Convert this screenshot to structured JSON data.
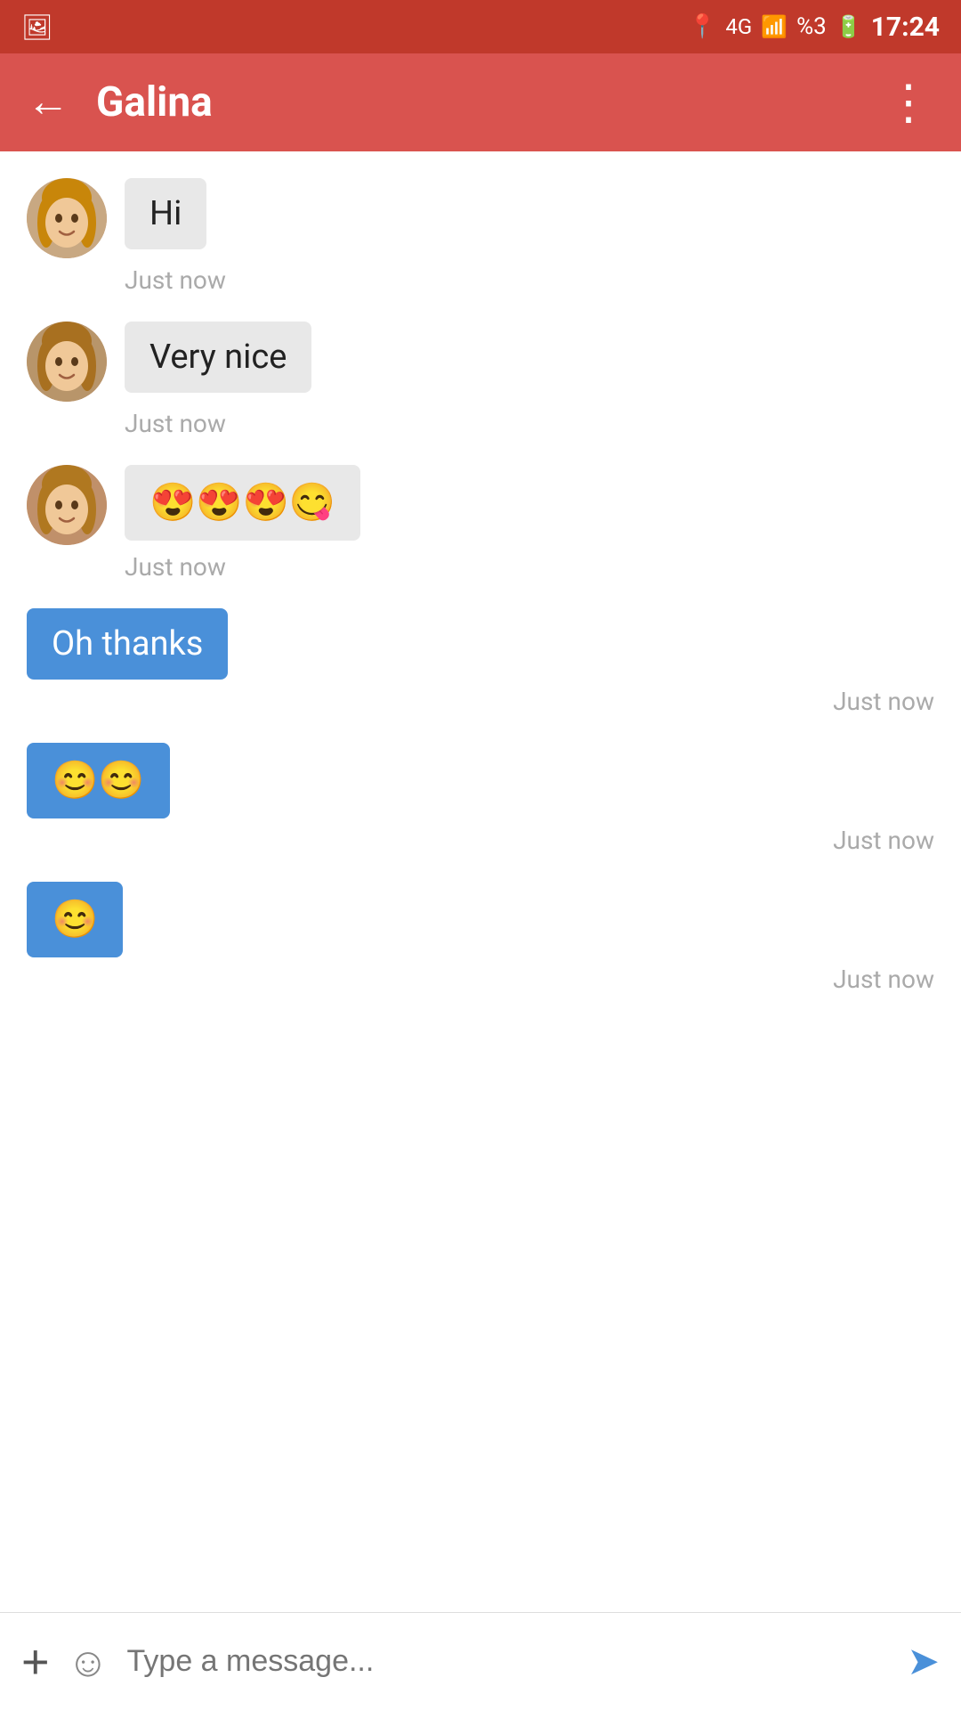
{
  "statusBar": {
    "time": "17:24",
    "battery": "%3"
  },
  "header": {
    "title": "Galina",
    "backLabel": "←",
    "moreLabel": "⋮"
  },
  "messages": [
    {
      "id": 1,
      "side": "left",
      "text": "Hi",
      "timestamp": "Just now",
      "hasAvatar": true
    },
    {
      "id": 2,
      "side": "left",
      "text": "Very nice",
      "timestamp": "Just now",
      "hasAvatar": true
    },
    {
      "id": 3,
      "side": "left",
      "text": "😍😍😍😋",
      "timestamp": "Just now",
      "hasAvatar": true
    },
    {
      "id": 4,
      "side": "right",
      "text": "Oh thanks",
      "timestamp": "Just now",
      "hasAvatar": false
    },
    {
      "id": 5,
      "side": "right",
      "text": "😊😊",
      "timestamp": "Just now",
      "hasAvatar": false
    },
    {
      "id": 6,
      "side": "right",
      "text": "😊",
      "timestamp": "Just now",
      "hasAvatar": false
    }
  ],
  "inputBar": {
    "placeholder": "Type a message...",
    "addIcon": "+",
    "emojiIcon": "☺",
    "sendIcon": "➤"
  }
}
